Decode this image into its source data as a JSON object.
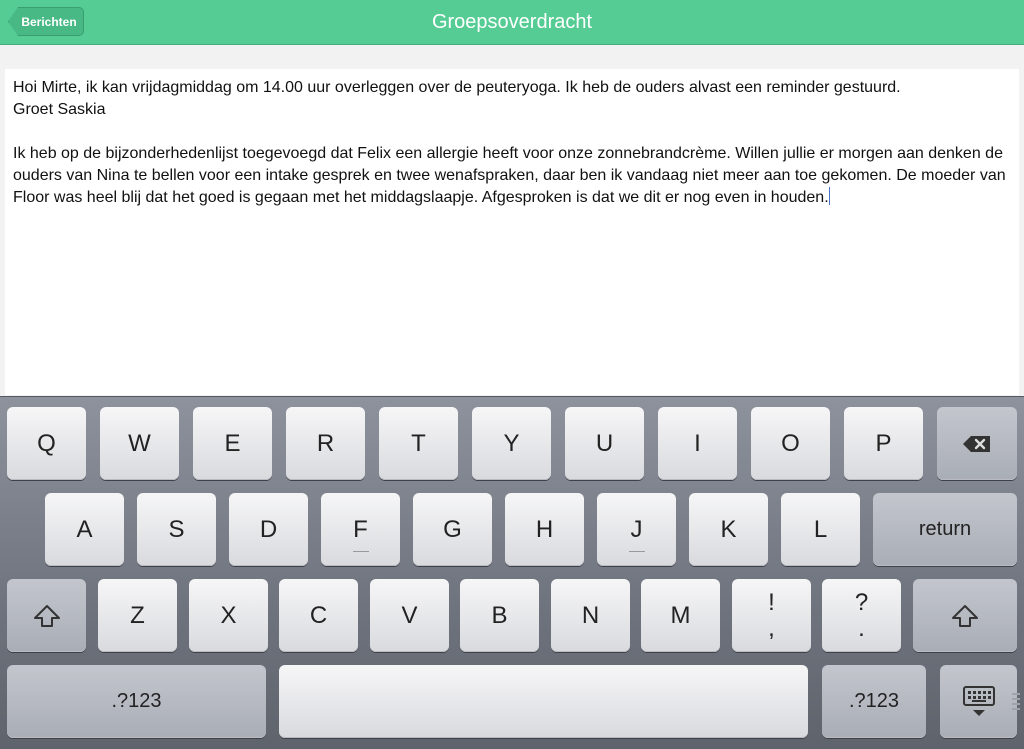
{
  "navbar": {
    "back_label": "Berichten",
    "title": "Groepsoverdracht"
  },
  "note": {
    "paragraph1_line1": "Hoi Mirte, ik kan vrijdagmiddag om 14.00 uur overleggen over de peuteryoga. Ik heb de ouders alvast een reminder gestuurd.",
    "paragraph1_line2": "Groet Saskia",
    "paragraph2": "Ik heb op de bijzonderhedenlijst toegevoegd dat Felix een allergie heeft voor onze zonnebrandcrème. Willen jullie er morgen aan denken de ouders van Nina te bellen voor een intake gesprek en twee wenafspraken, daar ben ik vandaag niet meer aan toe gekomen. De moeder van Floor was heel blij dat het goed is gegaan met het middagslaapje. Afgesproken is dat we dit er nog even in houden."
  },
  "keyboard": {
    "row1": [
      "Q",
      "W",
      "E",
      "R",
      "T",
      "Y",
      "U",
      "I",
      "O",
      "P"
    ],
    "row2": [
      "A",
      "S",
      "D",
      "F",
      "G",
      "H",
      "J",
      "K",
      "L"
    ],
    "row3": [
      "Z",
      "X",
      "C",
      "V",
      "B",
      "N",
      "M"
    ],
    "return_label": "return",
    "numbers_label": ".?123",
    "exclaim_top": "!",
    "exclaim_bottom": ",",
    "question_top": "?",
    "question_bottom": ".",
    "icons": [
      "backspace-icon",
      "shift-icon",
      "hide-keyboard-icon"
    ]
  },
  "colors": {
    "navbar": "#55cc94",
    "caret": "#4a74c9"
  }
}
